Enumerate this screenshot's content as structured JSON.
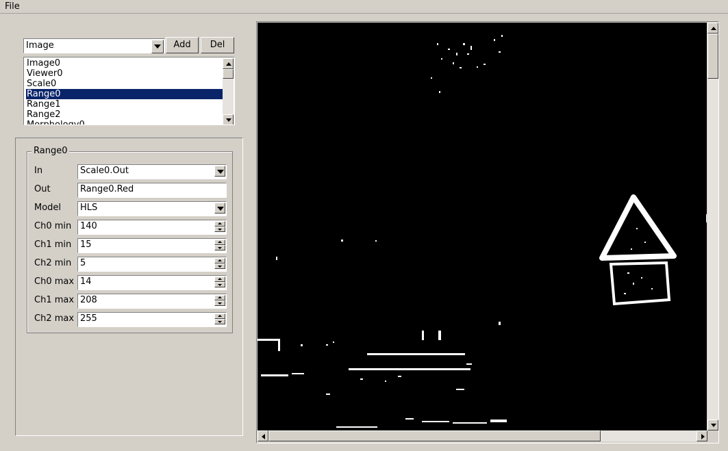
{
  "menubar": {
    "file": "File"
  },
  "node_toolbar": {
    "type_select_value": "Image",
    "add_label": "Add",
    "del_label": "Del"
  },
  "node_list": {
    "items": [
      "Image0",
      "Viewer0",
      "Scale0",
      "Range0",
      "Range1",
      "Range2",
      "Morphology0"
    ],
    "selected": "Range0"
  },
  "properties": {
    "group_title": "Range0",
    "fields": [
      {
        "label": "In",
        "value": "Scale0.Out",
        "kind": "select"
      },
      {
        "label": "Out",
        "value": "Range0.Red",
        "kind": "text"
      },
      {
        "label": "Model",
        "value": "HLS",
        "kind": "select"
      },
      {
        "label": "Ch0 min",
        "value": "140",
        "kind": "spin"
      },
      {
        "label": "Ch1 min",
        "value": "15",
        "kind": "spin"
      },
      {
        "label": "Ch2 min",
        "value": "5",
        "kind": "spin"
      },
      {
        "label": "Ch0 max",
        "value": "14",
        "kind": "spin"
      },
      {
        "label": "Ch1 max",
        "value": "208",
        "kind": "spin"
      },
      {
        "label": "Ch2 max",
        "value": "255",
        "kind": "spin"
      }
    ]
  },
  "viewer": {
    "background": "#000000",
    "foreground": "#ffffff"
  },
  "colors": {
    "window_bg": "#d4d0c8",
    "selection_bg": "#0a246a",
    "selection_fg": "#ffffff"
  }
}
